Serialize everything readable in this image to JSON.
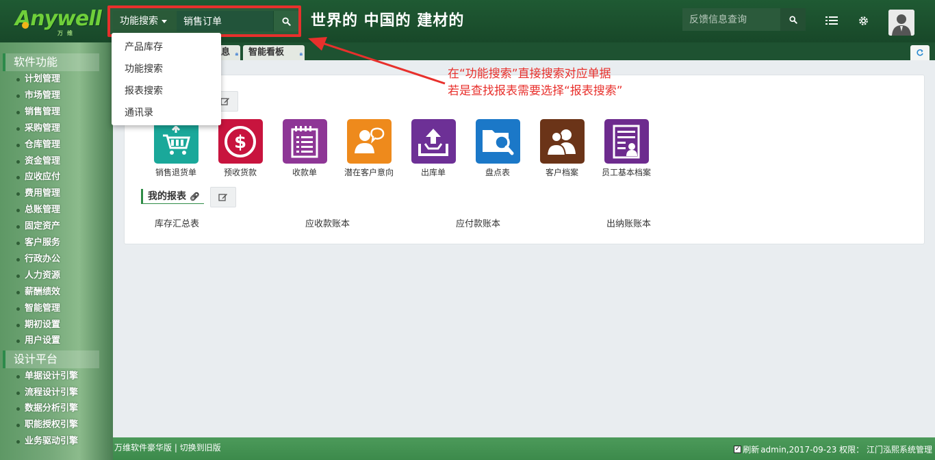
{
  "logo": {
    "text": "Anywell",
    "sub": "万维"
  },
  "search": {
    "mode_label": "功能搜索",
    "value": "销售订单"
  },
  "slogan": "世界的 中国的 建材的",
  "feedback": {
    "placeholder": "反馈信息查询"
  },
  "dropdown": {
    "items": [
      "产品库存",
      "功能搜索",
      "报表搜索",
      "通讯录"
    ]
  },
  "sidebar": {
    "section1": "软件功能",
    "items1": [
      "计划管理",
      "市场管理",
      "销售管理",
      "采购管理",
      "仓库管理",
      "资金管理",
      "应收应付",
      "费用管理",
      "总账管理",
      "固定资产",
      "客户服务",
      "行政办公",
      "人力资源",
      "薪酬绩效",
      "智能管理",
      "期初设置",
      "用户设置"
    ],
    "section2": "设计平台",
    "items2": [
      "单据设计引擎",
      "流程设计引擎",
      "数据分析引擎",
      "职能授权引擎",
      "业务驱动引擎"
    ]
  },
  "tabs": {
    "tab1": "息",
    "tab2": "智能看板"
  },
  "apps": [
    {
      "label": "销售退货单",
      "icon": "cart-return-icon",
      "color": "#1aa89a"
    },
    {
      "label": "预收货款",
      "icon": "dollar-icon",
      "color": "#c8143e"
    },
    {
      "label": "收款单",
      "icon": "notepad-icon",
      "color": "#8e3696"
    },
    {
      "label": "潜在客户意向",
      "icon": "person-chat-icon",
      "color": "#ee8a1c"
    },
    {
      "label": "出库单",
      "icon": "tray-upload-icon",
      "color": "#6d3096"
    },
    {
      "label": "盘点表",
      "icon": "folder-search-icon",
      "color": "#1b78c8"
    },
    {
      "label": "客户档案",
      "icon": "users-icon",
      "color": "#6b3418"
    },
    {
      "label": "员工基本档案",
      "icon": "id-card-icon",
      "color": "#6d2b8e"
    }
  ],
  "reports": {
    "title": "我的报表",
    "items": [
      "库存汇总表",
      "应收款账本",
      "应付款账本",
      "出纳账账本"
    ]
  },
  "annotation": {
    "line1": "在“功能搜索”直接搜索对应单据",
    "line2": "若是查找报表需要选择“报表搜索”"
  },
  "footer": {
    "left": "万维软件豪华版 | 切换到旧版",
    "refresh_label": "刷新",
    "status": "admin,2017-09-23 权限： 江门泓熙系统管理"
  },
  "colors": {
    "header": "#1f5a33",
    "accent": "#e8302c",
    "footer": "#3c8a4b"
  }
}
